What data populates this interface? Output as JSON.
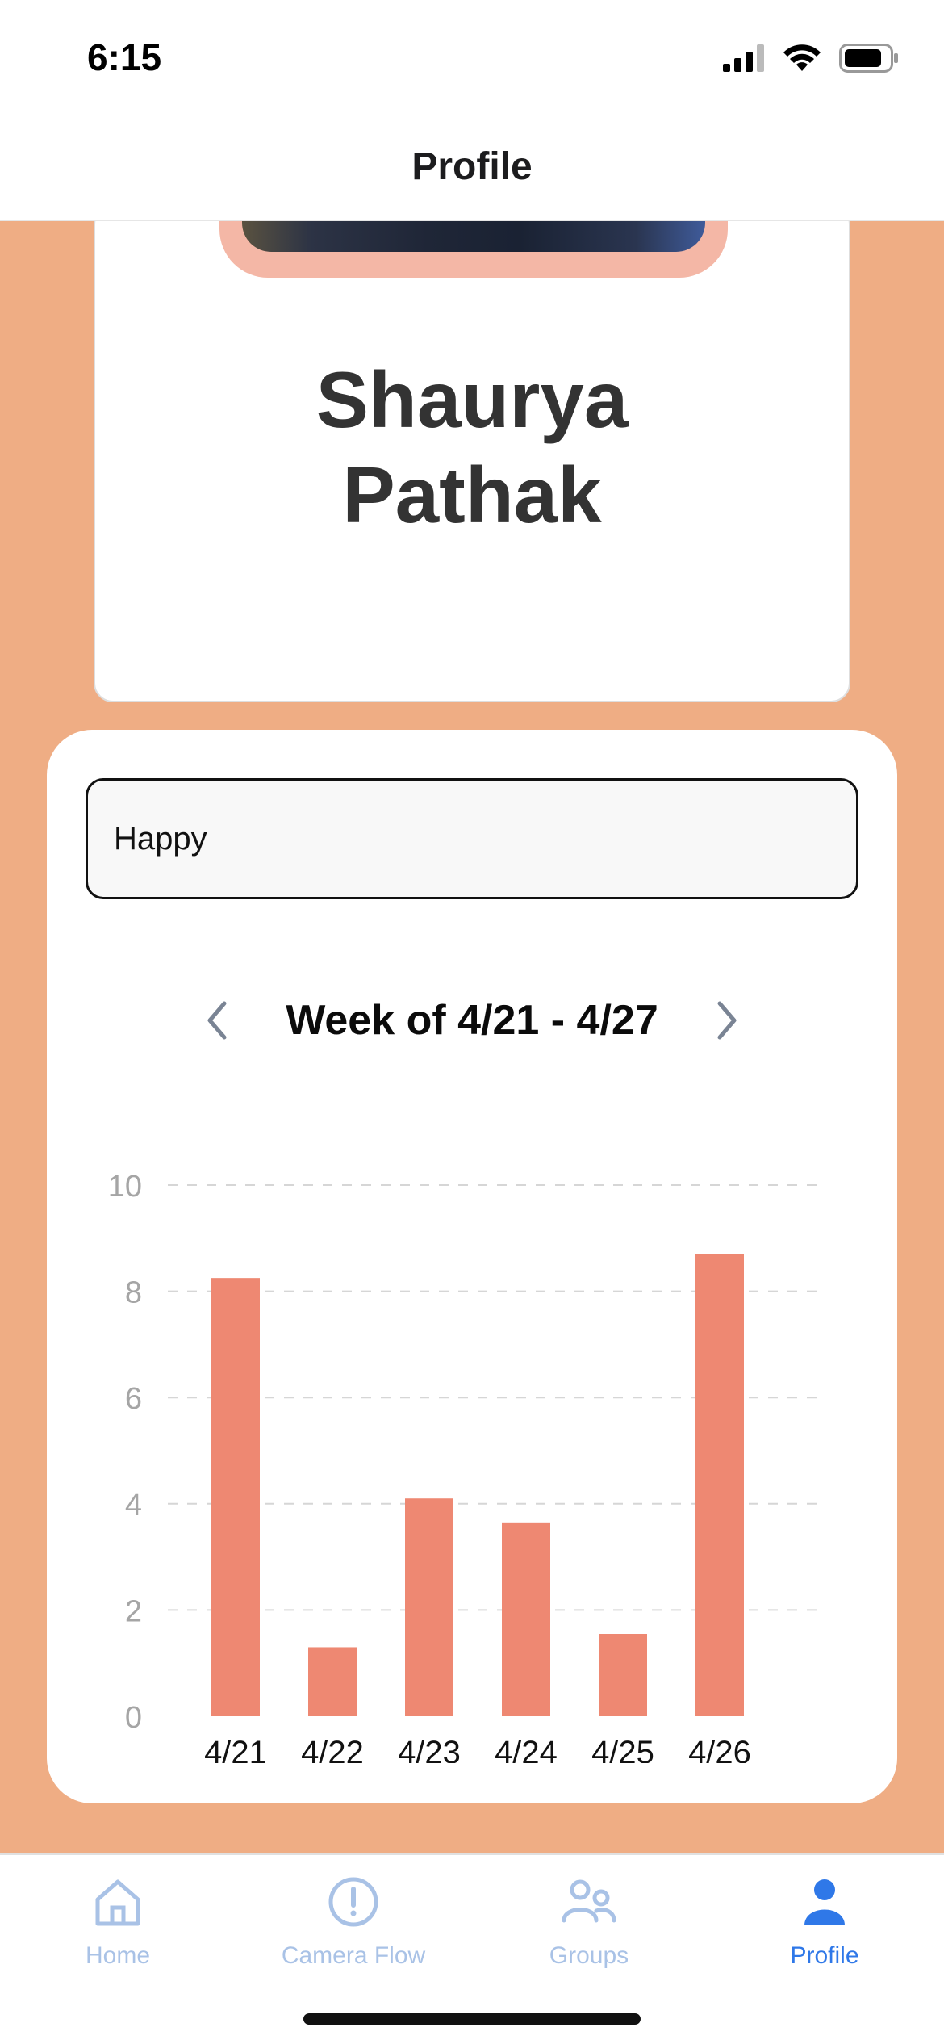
{
  "status_bar": {
    "time": "6:15",
    "icons": [
      "signal-icon",
      "wifi-icon",
      "battery-icon"
    ]
  },
  "header": {
    "title": "Profile"
  },
  "profile": {
    "first_name": "Shaurya",
    "last_name": "Pathak"
  },
  "mood_field": {
    "value": "Happy"
  },
  "week_nav": {
    "label": "Week of 4/21 - 4/27",
    "prev_icon": "chevron-left-icon",
    "next_icon": "chevron-right-icon"
  },
  "chart_data": {
    "type": "bar",
    "categories": [
      "4/21",
      "4/22",
      "4/23",
      "4/24",
      "4/25",
      "4/26"
    ],
    "values": [
      8.25,
      1.3,
      4.1,
      3.65,
      1.55,
      8.7
    ],
    "ylim": [
      0,
      10
    ],
    "yticks": [
      0,
      2,
      4,
      6,
      8,
      10
    ],
    "grid": true,
    "bar_color": "#EE8872"
  },
  "tabs": [
    {
      "label": "Home",
      "icon": "home-icon",
      "active": false
    },
    {
      "label": "Camera Flow",
      "icon": "alert-circle-icon",
      "active": false
    },
    {
      "label": "Groups",
      "icon": "groups-icon",
      "active": false
    },
    {
      "label": "Profile",
      "icon": "person-icon",
      "active": true
    }
  ],
  "colors": {
    "background": "#EFAD84",
    "accent": "#2F78E8",
    "tab_inactive": "#A9C2E6",
    "avatar_frame": "#F4B7A6"
  }
}
